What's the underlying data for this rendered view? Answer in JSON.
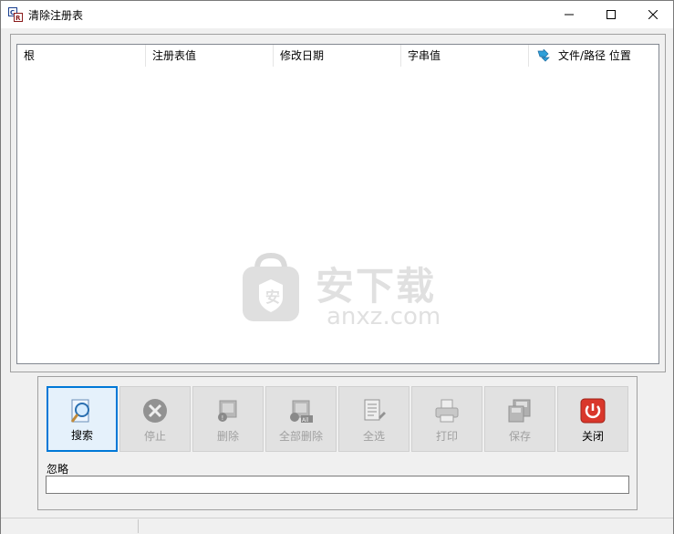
{
  "window": {
    "title": "清除注册表",
    "minimize_icon": "minimize-icon",
    "maximize_icon": "maximize-icon",
    "close_icon": "close-icon"
  },
  "list": {
    "columns": [
      "根",
      "注册表值",
      "修改日期",
      "字串值",
      "文件/路径 位置"
    ],
    "rows": []
  },
  "watermark": {
    "cn": "安下载",
    "en": "anxz.com"
  },
  "toolbar": {
    "buttons": [
      {
        "label": "搜索",
        "icon": "search-icon",
        "enabled": true
      },
      {
        "label": "停止",
        "icon": "stop-icon",
        "enabled": false
      },
      {
        "label": "删除",
        "icon": "delete-icon",
        "enabled": false
      },
      {
        "label": "全部删除",
        "icon": "delete-all-icon",
        "enabled": false
      },
      {
        "label": "全选",
        "icon": "select-all-icon",
        "enabled": false
      },
      {
        "label": "打印",
        "icon": "print-icon",
        "enabled": false
      },
      {
        "label": "保存",
        "icon": "save-icon",
        "enabled": false
      },
      {
        "label": "关闭",
        "icon": "power-icon",
        "enabled": true
      }
    ]
  },
  "ignore": {
    "label": "忽略",
    "value": ""
  },
  "colors": {
    "accent": "#0078d7",
    "close_red": "#d9372b"
  }
}
